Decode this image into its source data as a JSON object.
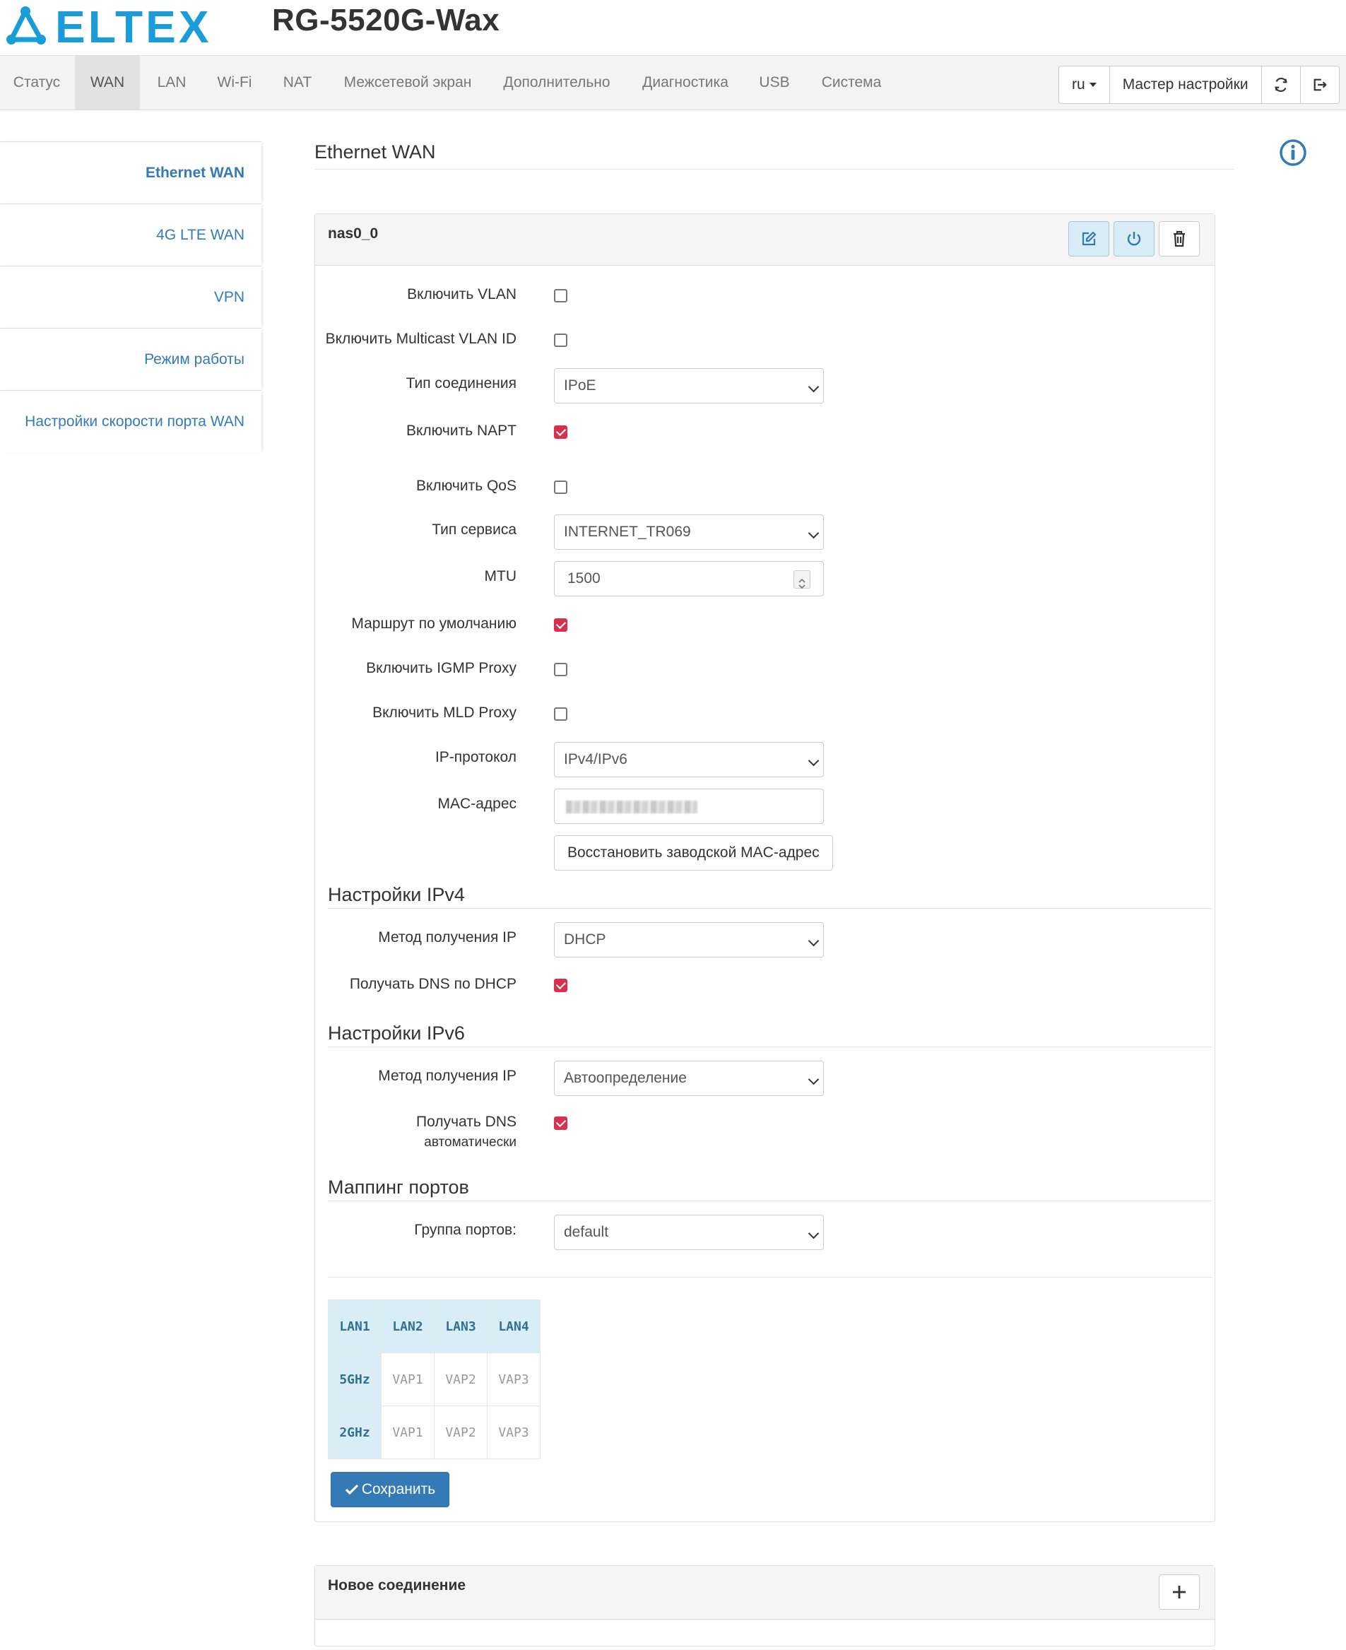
{
  "header": {
    "brand": "ELTEX",
    "product": "RG-5520G-Wax"
  },
  "nav": {
    "items": [
      "Статус",
      "WAN",
      "LAN",
      "Wi-Fi",
      "NAT",
      "Межсетевой экран",
      "Дополнительно",
      "Диагностика",
      "USB",
      "Система"
    ],
    "active": "WAN",
    "lang": "ru",
    "wizard": "Мастер настройки"
  },
  "sidebar": {
    "items": [
      "Ethernet WAN",
      "4G LTE WAN",
      "VPN",
      "Режим работы",
      "Настройки скорости порта WAN"
    ],
    "active": "Ethernet WAN"
  },
  "page": {
    "heading": "Ethernet WAN"
  },
  "connection": {
    "name": "nas0_0",
    "fields": {
      "vlan_label": "Включить VLAN",
      "vlan": false,
      "mcast_vlan_label": "Включить Multicast VLAN ID",
      "mcast_vlan": false,
      "conn_type_label": "Тип соединения",
      "conn_type": "IPoE",
      "napt_label": "Включить NAPT",
      "napt": true,
      "qos_label": "Включить QoS",
      "qos": false,
      "service_type_label": "Тип сервиса",
      "service_type": "INTERNET_TR069",
      "mtu_label": "MTU",
      "mtu": "1500",
      "default_route_label": "Маршрут по умолчанию",
      "default_route": true,
      "igmp_label": "Включить IGMP Proxy",
      "igmp": false,
      "mld_label": "Включить MLD Proxy",
      "mld": false,
      "ip_proto_label": "IP-протокол",
      "ip_proto": "IPv4/IPv6",
      "mac_label": "MAC-адрес",
      "restore_mac_button": "Восстановить заводской MAC-адрес"
    },
    "ipv4": {
      "title": "Настройки IPv4",
      "method_label": "Метод получения IP",
      "method": "DHCP",
      "dns_label": "Получать DNS по DHCP",
      "dns": true
    },
    "ipv6": {
      "title": "Настройки IPv6",
      "method_label": "Метод получения IP",
      "method": "Автоопределение",
      "dns_label_1": "Получать DNS",
      "dns_label_2": "автоматически",
      "dns": true
    },
    "port_mapping": {
      "title": "Маппинг портов",
      "group_label": "Группа портов:",
      "group": "default",
      "rows": [
        [
          "LAN1",
          "LAN2",
          "LAN3",
          "LAN4"
        ],
        [
          "5GHz",
          "VAP1",
          "VAP2",
          "VAP3"
        ],
        [
          "2GHz",
          "VAP1",
          "VAP2",
          "VAP3"
        ]
      ]
    },
    "save_button": "Сохранить"
  },
  "new_connection": {
    "title": "Новое соединение"
  },
  "colors": {
    "accent": "#337ab7",
    "check": "#d9304f",
    "brand": "#1a9cd8"
  }
}
